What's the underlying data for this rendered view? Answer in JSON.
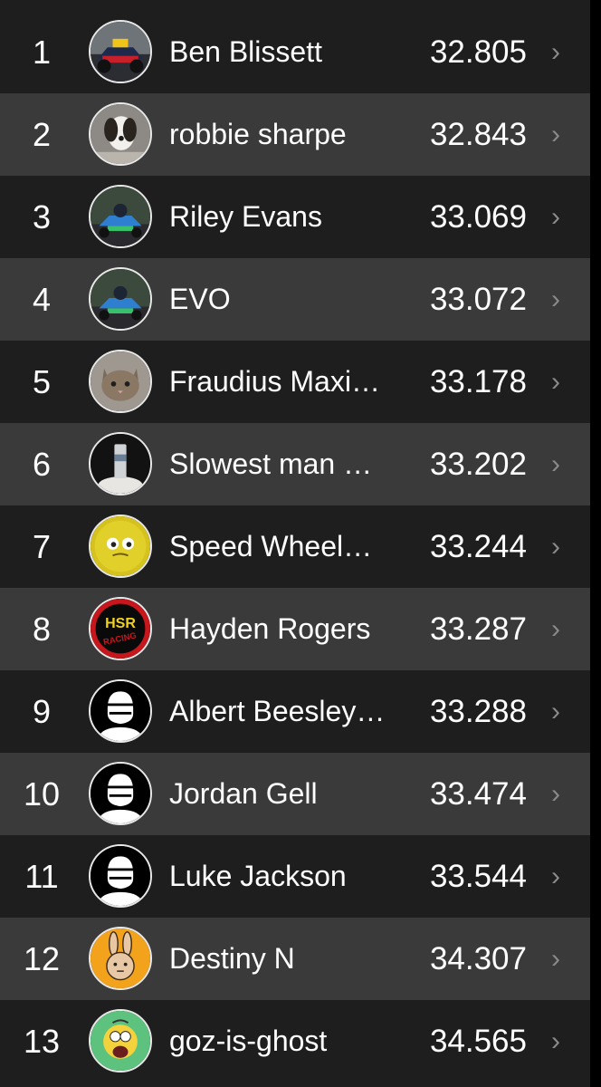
{
  "colors": {
    "row_dark": "#1e1e1e",
    "row_light": "#3a3a3a",
    "text": "#ffffff",
    "chevron": "#8a8a8a"
  },
  "leaderboard": {
    "chevron_icon": "chevron-right-icon",
    "chevron_glyph": "›",
    "rows": [
      {
        "rank": "1",
        "name": "Ben Blissett",
        "time": "32.805",
        "avatar": "race-car-photo-avatar"
      },
      {
        "rank": "2",
        "name": "robbie sharpe",
        "time": "32.843",
        "avatar": "dog-photo-avatar"
      },
      {
        "rank": "3",
        "name": "Riley Evans",
        "time": "33.069",
        "avatar": "karting-photo-avatar"
      },
      {
        "rank": "4",
        "name": "EVO",
        "time": "33.072",
        "avatar": "karting-photo-avatar"
      },
      {
        "rank": "5",
        "name": "Fraudius Maxi…",
        "time": "33.178",
        "avatar": "cat-photo-avatar"
      },
      {
        "rank": "6",
        "name": "Slowest man …",
        "time": "33.202",
        "avatar": "can-photo-avatar"
      },
      {
        "rank": "7",
        "name": "Speed Wheel…",
        "time": "33.244",
        "avatar": "yellow-face-avatar"
      },
      {
        "rank": "8",
        "name": "Hayden Rogers",
        "time": "33.287",
        "avatar": "hsr-racing-logo-avatar"
      },
      {
        "rank": "9",
        "name": "Albert Beesley…",
        "time": "33.288",
        "avatar": "default-helmet-avatar"
      },
      {
        "rank": "10",
        "name": "Jordan Gell",
        "time": "33.474",
        "avatar": "default-helmet-avatar"
      },
      {
        "rank": "11",
        "name": "Luke Jackson",
        "time": "33.544",
        "avatar": "default-helmet-avatar"
      },
      {
        "rank": "12",
        "name": "Destiny N",
        "time": "34.307",
        "avatar": "bunny-cartoon-avatar"
      },
      {
        "rank": "13",
        "name": "goz-is-ghost",
        "time": "34.565",
        "avatar": "homer-cartoon-avatar"
      }
    ]
  },
  "logos": {
    "hsr_text_top": "HSR",
    "hsr_text_bottom": "RACING"
  }
}
